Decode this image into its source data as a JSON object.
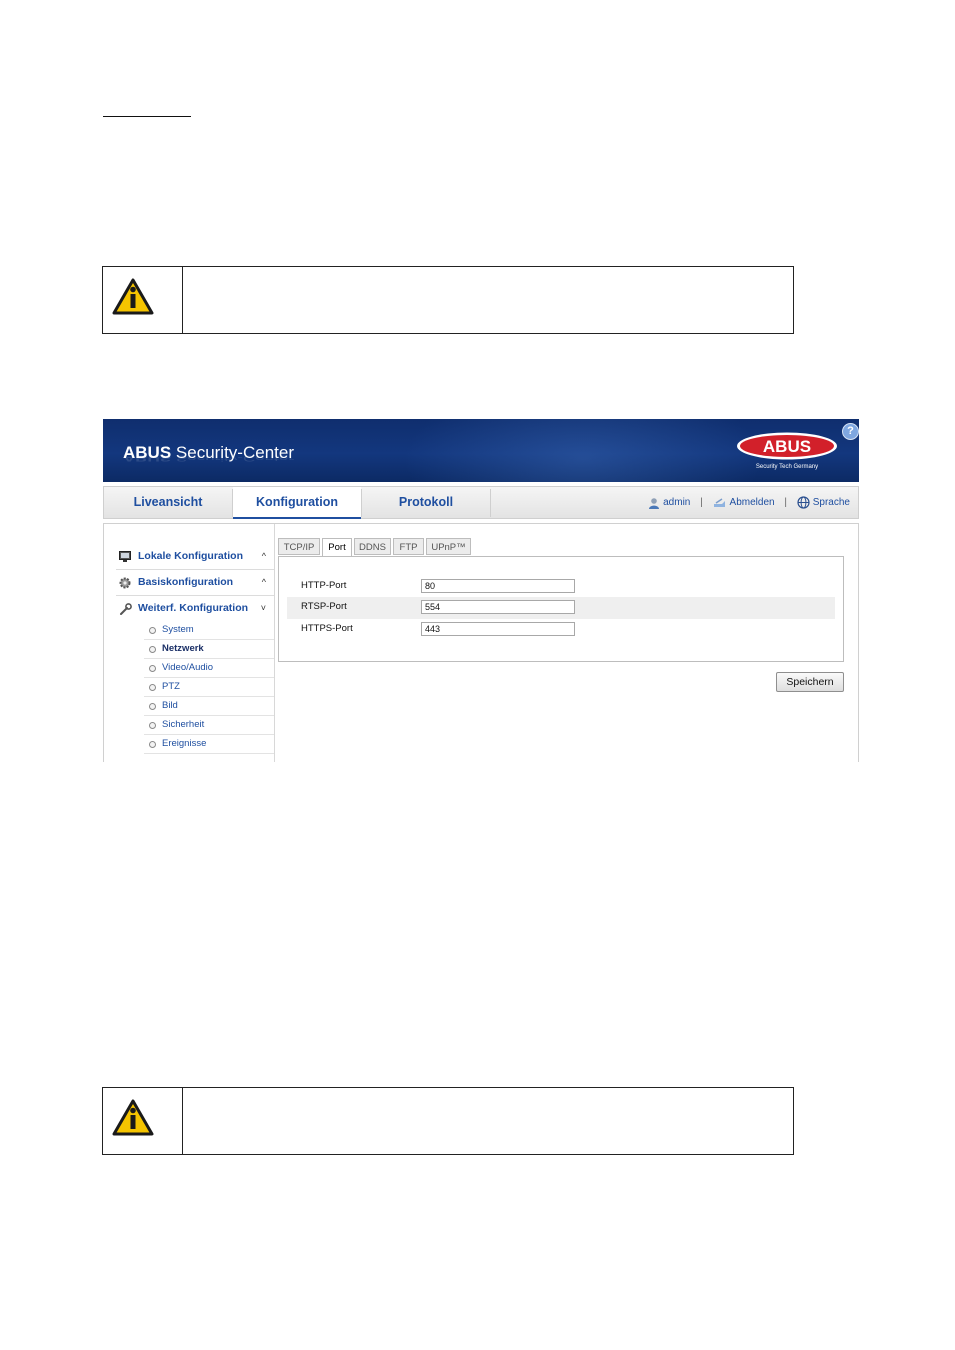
{
  "app": {
    "title_bold": "ABUS",
    "title_rest": " Security-Center",
    "help_label": "?",
    "logo_text": "ABUS",
    "logo_tagline": "Security Tech Germany"
  },
  "nav": {
    "tabs": [
      {
        "label": "Liveansicht",
        "active": false
      },
      {
        "label": "Konfiguration",
        "active": true
      },
      {
        "label": "Protokoll",
        "active": false
      }
    ],
    "user": "admin",
    "logout": "Abmelden",
    "language": "Sprache"
  },
  "sidebar": {
    "items": [
      {
        "label": "Lokale Konfiguration",
        "icon": "monitor-icon",
        "chevron": "^"
      },
      {
        "label": "Basiskonfiguration",
        "icon": "gear-icon",
        "chevron": "^"
      },
      {
        "label": "Weiterf. Konfiguration",
        "icon": "wrench-icon",
        "chevron": "˅"
      }
    ],
    "subitems": [
      "System",
      "Netzwerk",
      "Video/Audio",
      "PTZ",
      "Bild",
      "Sicherheit",
      "Ereignisse"
    ],
    "active_subitem": "Netzwerk"
  },
  "subtabs": [
    "TCP/IP",
    "Port",
    "DDNS",
    "FTP",
    "UPnP™"
  ],
  "active_subtab": "Port",
  "form": {
    "fields": [
      {
        "label": "HTTP-Port",
        "value": "80"
      },
      {
        "label": "RTSP-Port",
        "value": "554"
      },
      {
        "label": "HTTPS-Port",
        "value": "443"
      }
    ]
  },
  "save_label": "Speichern",
  "colors": {
    "banner": "#13377e",
    "link": "#1f4fa0",
    "logo_red": "#d2202a",
    "warning_yellow": "#f5c400"
  }
}
